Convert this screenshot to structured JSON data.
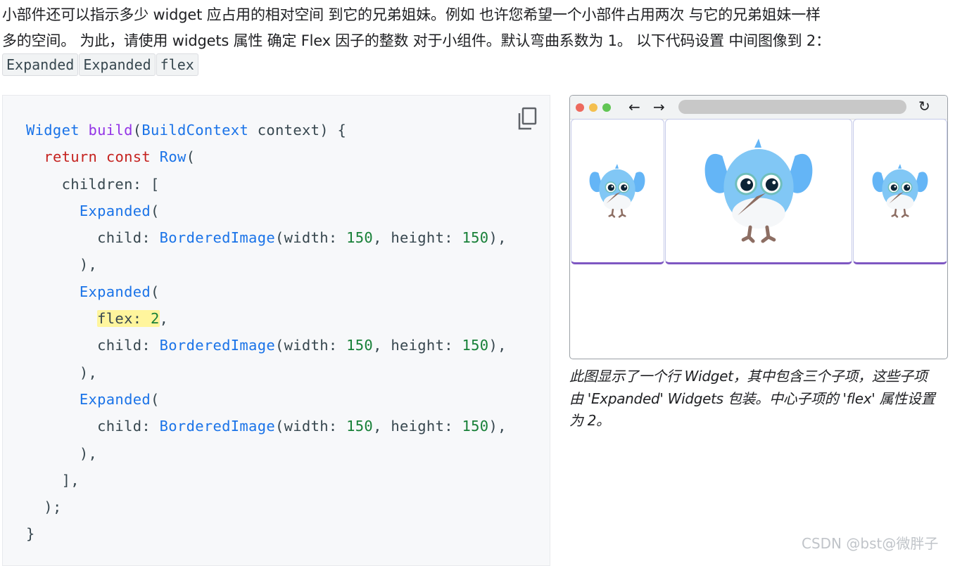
{
  "intro": {
    "line1": "小部件还可以指示多少 widget 应占用的相对空间 到它的兄弟姐妹。例如 也许您希望一个小部件占用两次 与它的兄弟姐妹一样",
    "line2": "多的空间。 为此，请使用 widgets 属性 确定 Flex 因子的整数 对于小组件。默认弯曲系数为 1。 以下代码设置 中间图像到 2："
  },
  "chips": [
    "Expanded",
    "Expanded",
    "flex"
  ],
  "code": {
    "l1": {
      "widget": "Widget",
      "build": "build",
      "open": "(",
      "ctx": "BuildContext",
      "rest": " context) {"
    },
    "l2": {
      "ret": "return",
      "cnst": "const",
      "row": "Row",
      "open": "("
    },
    "l3": "children: [",
    "expanded": "Expanded",
    "open_paren": "(",
    "child_label": "child: ",
    "bordered": "BorderedImage",
    "args_w": "(width: ",
    "num": "150",
    "args_h": ", height: ",
    "args_end": "),",
    "close_expanded": "),",
    "flex_label": "flex: ",
    "flex_value": "2",
    "comma": ",",
    "close_list": "],",
    "close_row": ");",
    "close_fn": "}"
  },
  "browser": {
    "colors": {
      "red": "#ed6a5e",
      "yellow": "#f4bf4f",
      "green": "#61c554"
    },
    "back_icon": "←",
    "forward_icon": "→",
    "reload_icon": "↻"
  },
  "caption": {
    "line1": "此图显示了一个行 Widget，其中包含三个子项，这些子项",
    "line2": "由 'Expanded' Widgets 包装。中心子项的 'flex' 属性设置",
    "line3": "为 2。"
  },
  "watermark": "CSDN @bst@微胖子",
  "colors": {
    "accent": "#7e57c2",
    "code_bg": "#f7f8fa",
    "highlight": "#fff59d"
  }
}
